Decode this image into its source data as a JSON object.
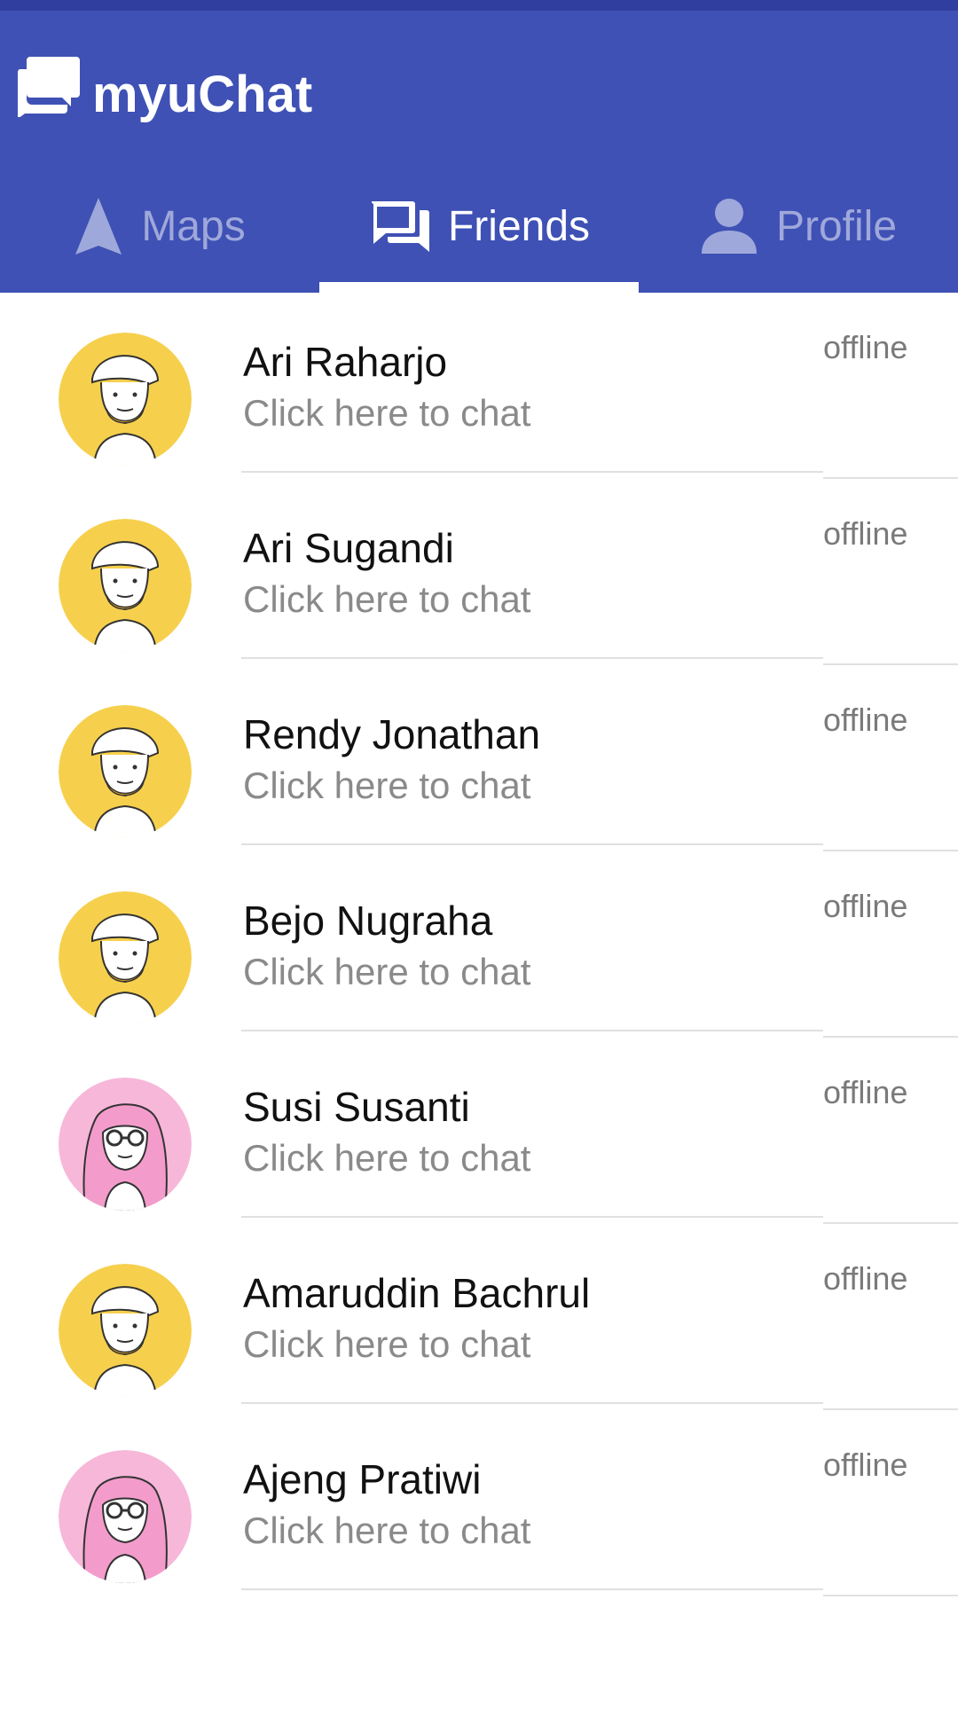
{
  "app": {
    "title": "myuChat",
    "logo_icon": "chat-bubbles-icon",
    "primary_color": "#3f51b5",
    "status_bar_color": "#303f9f"
  },
  "tabs": [
    {
      "label": "Maps",
      "icon": "navigation-arrow-icon",
      "active": false
    },
    {
      "label": "Friends",
      "icon": "chat-icon",
      "active": true
    },
    {
      "label": "Profile",
      "icon": "person-icon",
      "active": false
    }
  ],
  "friends": [
    {
      "name": "Ari Raharjo",
      "subtitle": "Click here to chat",
      "status": "offline",
      "avatar": "male-avatar",
      "avatar_color": "#f6d04d"
    },
    {
      "name": "Ari Sugandi",
      "subtitle": "Click here to chat",
      "status": "offline",
      "avatar": "male-avatar",
      "avatar_color": "#f6d04d"
    },
    {
      "name": "Rendy Jonathan",
      "subtitle": "Click here to chat",
      "status": "offline",
      "avatar": "male-avatar",
      "avatar_color": "#f6d04d"
    },
    {
      "name": "Bejo Nugraha",
      "subtitle": "Click here to chat",
      "status": "offline",
      "avatar": "male-avatar",
      "avatar_color": "#f6d04d"
    },
    {
      "name": "Susi Susanti",
      "subtitle": "Click here to chat",
      "status": "offline",
      "avatar": "female-avatar",
      "avatar_color": "#f7b7d9"
    },
    {
      "name": "Amaruddin Bachrul",
      "subtitle": "Click here to chat",
      "status": "offline",
      "avatar": "male-avatar",
      "avatar_color": "#f6d04d"
    },
    {
      "name": "Ajeng Pratiwi",
      "subtitle": "Click here to chat",
      "status": "offline",
      "avatar": "female-avatar",
      "avatar_color": "#f7b7d9"
    }
  ]
}
